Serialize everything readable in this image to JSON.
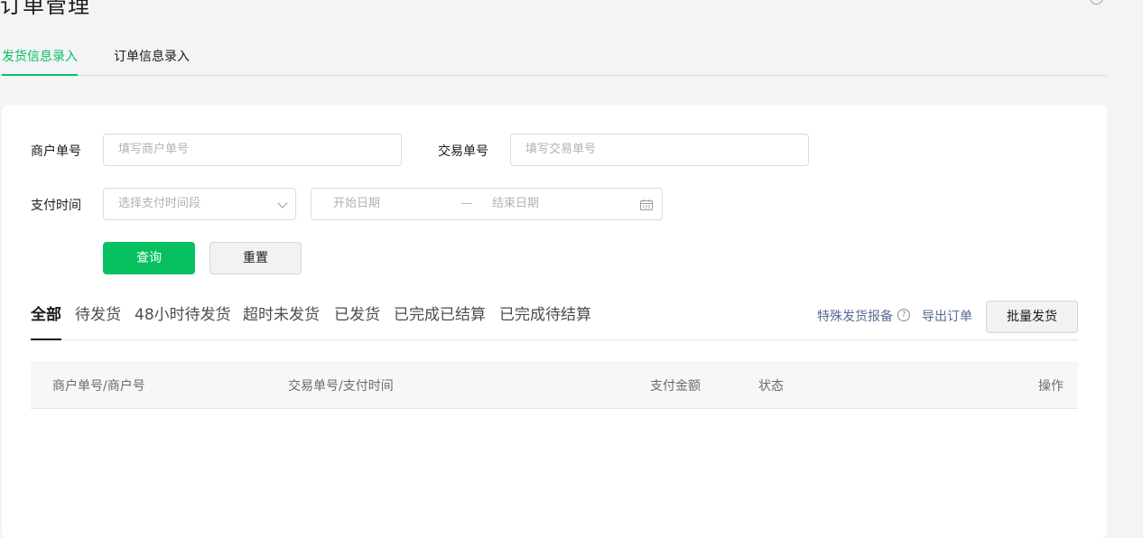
{
  "page": {
    "title": "订单管理",
    "help_icon": "help-icon"
  },
  "top_tabs": [
    {
      "label": "发货信息录入",
      "active": true
    },
    {
      "label": "订单信息录入",
      "active": false
    }
  ],
  "form": {
    "merchant_order": {
      "label": "商户单号",
      "placeholder": "填写商户单号"
    },
    "transaction_no": {
      "label": "交易单号",
      "placeholder": "填写交易单号"
    },
    "pay_time": {
      "label": "支付时间",
      "select_placeholder": "选择支付时间段",
      "start_placeholder": "开始日期",
      "separator": "—",
      "end_placeholder": "结束日期"
    },
    "search_button": "查询",
    "reset_button": "重置"
  },
  "status_tabs": [
    {
      "label": "全部",
      "active": true
    },
    {
      "label": "待发货",
      "active": false
    },
    {
      "label": "48小时待发货",
      "active": false
    },
    {
      "label": "超时未发货",
      "active": false
    },
    {
      "label": "已发货",
      "active": false
    },
    {
      "label": "已完成已结算",
      "active": false
    },
    {
      "label": "已完成待结算",
      "active": false
    }
  ],
  "actions": {
    "special_report": "特殊发货报备",
    "export": "导出订单",
    "batch_ship": "批量发货"
  },
  "table": {
    "columns": [
      "商户单号/商户号",
      "交易单号/支付时间",
      "支付金额",
      "状态",
      "操作"
    ]
  },
  "colors": {
    "accent": "#07c160",
    "link": "#576b95"
  }
}
